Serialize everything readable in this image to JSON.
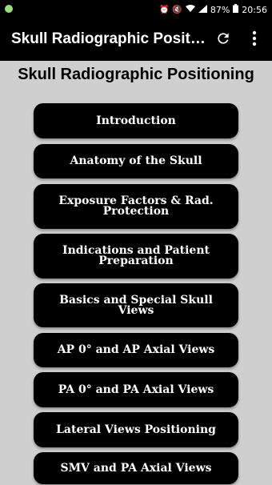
{
  "status": {
    "battery": "87%",
    "time": "20:56"
  },
  "appbar": {
    "title": "Skull Radiographic Positio..."
  },
  "heading": "Skull Radiographic Positioning",
  "menu": [
    {
      "label": "Introduction"
    },
    {
      "label": "Anatomy of the Skull"
    },
    {
      "label": "Exposure Factors & Rad. Protection"
    },
    {
      "label": "Indications and Patient Preparation"
    },
    {
      "label": "Basics and Special Skull Views"
    },
    {
      "label": "AP 0° and AP Axial Views"
    },
    {
      "label": "PA 0° and PA Axial Views"
    },
    {
      "label": "Lateral Views Positioning"
    },
    {
      "label": "SMV and PA Axial Views"
    }
  ]
}
